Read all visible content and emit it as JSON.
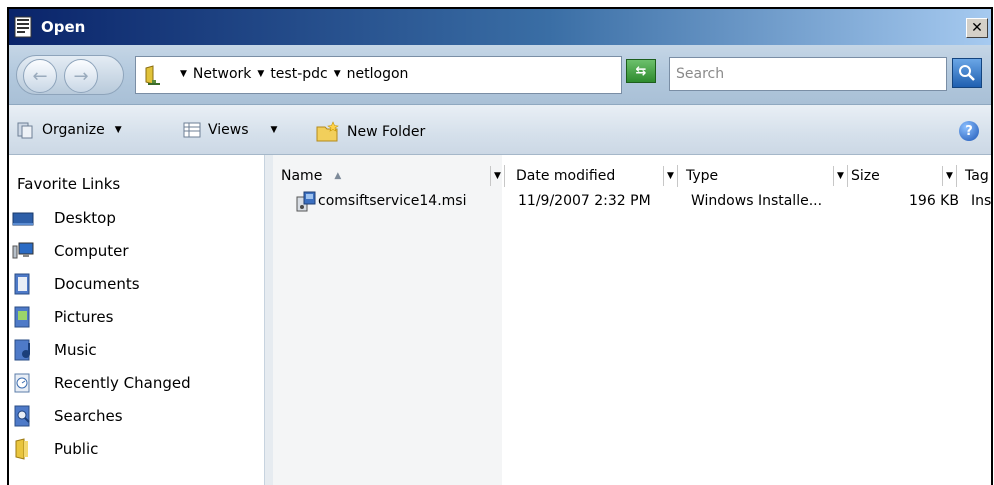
{
  "window": {
    "title": "Open",
    "close_label": "✕"
  },
  "address": {
    "breadcrumbs": [
      "Network",
      "test-pdc",
      "netlogon"
    ],
    "search_placeholder": "Search"
  },
  "commands": {
    "organize": "Organize",
    "views": "Views",
    "new_folder": "New Folder",
    "help": "?"
  },
  "navpane": {
    "title": "Favorite Links",
    "items": [
      {
        "label": "Desktop",
        "icon": "desktop-icon"
      },
      {
        "label": "Computer",
        "icon": "computer-icon"
      },
      {
        "label": "Documents",
        "icon": "documents-icon"
      },
      {
        "label": "Pictures",
        "icon": "pictures-icon"
      },
      {
        "label": "Music",
        "icon": "music-icon"
      },
      {
        "label": "Recently Changed",
        "icon": "recently-changed-icon"
      },
      {
        "label": "Searches",
        "icon": "searches-icon"
      },
      {
        "label": "Public",
        "icon": "public-folder-icon"
      }
    ]
  },
  "filelist": {
    "columns": [
      "Name",
      "Date modified",
      "Type",
      "Size",
      "Tag"
    ],
    "rows": [
      {
        "name": "comsiftservice14.msi",
        "date_modified": "11/9/2007 2:32 PM",
        "type": "Windows Installe...",
        "size": "196 KB",
        "tags": "Ins"
      }
    ]
  }
}
